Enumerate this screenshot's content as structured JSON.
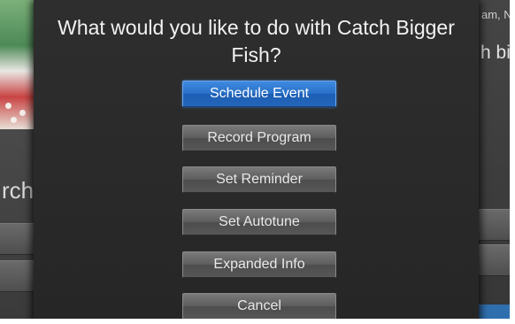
{
  "background": {
    "left_partial_text": "rch",
    "right_partial_top": "am, N",
    "right_partial_mid": "h big"
  },
  "dialog": {
    "title": "What would you like to do with Catch Bigger Fish?",
    "options": [
      {
        "label": "Schedule Event",
        "selected": true
      },
      {
        "label": "Record Program",
        "selected": false
      },
      {
        "label": "Set Reminder",
        "selected": false
      },
      {
        "label": "Set Autotune",
        "selected": false
      },
      {
        "label": "Expanded Info",
        "selected": false
      },
      {
        "label": "Cancel",
        "selected": false
      }
    ]
  },
  "colors": {
    "selected_accent": "#2a70c8",
    "dialog_background": "#2a2a2a",
    "button_gray": "#5e5e5e"
  }
}
